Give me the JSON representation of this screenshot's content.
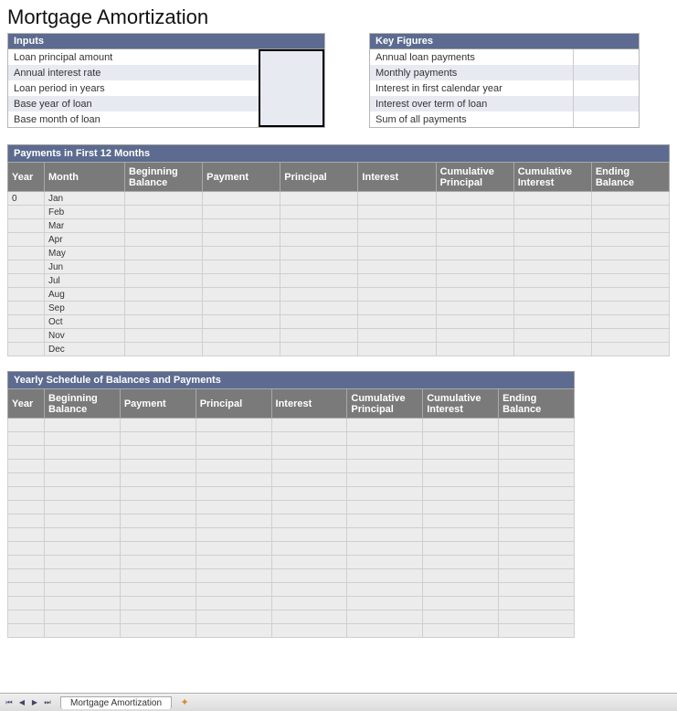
{
  "title": "Mortgage Amortization",
  "inputs_panel": {
    "title": "Inputs",
    "rows": [
      {
        "label": "Loan principal amount",
        "value": ""
      },
      {
        "label": "Annual interest rate",
        "value": ""
      },
      {
        "label": "Loan period in years",
        "value": ""
      },
      {
        "label": "Base year of loan",
        "value": ""
      },
      {
        "label": "Base month of loan",
        "value": ""
      }
    ]
  },
  "key_figures_panel": {
    "title": "Key Figures",
    "rows": [
      {
        "label": "Annual loan payments",
        "value": ""
      },
      {
        "label": "Monthly payments",
        "value": ""
      },
      {
        "label": "Interest in first calendar year",
        "value": ""
      },
      {
        "label": "Interest over term of loan",
        "value": ""
      },
      {
        "label": "Sum of all payments",
        "value": ""
      }
    ]
  },
  "first12": {
    "title": "Payments in First 12 Months",
    "headers": [
      "Year",
      "Month",
      "Beginning Balance",
      "Payment",
      "Principal",
      "Interest",
      "Cumulative Principal",
      "Cumulative Interest",
      "Ending Balance"
    ],
    "year0": "0",
    "months": [
      "Jan",
      "Feb",
      "Mar",
      "Apr",
      "May",
      "Jun",
      "Jul",
      "Aug",
      "Sep",
      "Oct",
      "Nov",
      "Dec"
    ]
  },
  "yearly": {
    "title": "Yearly Schedule of Balances and Payments",
    "headers": [
      "Year",
      "Beginning Balance",
      "Payment",
      "Principal",
      "Interest",
      "Cumulative Principal",
      "Cumulative Interest",
      "Ending Balance"
    ],
    "row_count": 16
  },
  "tabbar": {
    "sheet": "Mortgage Amortization"
  }
}
